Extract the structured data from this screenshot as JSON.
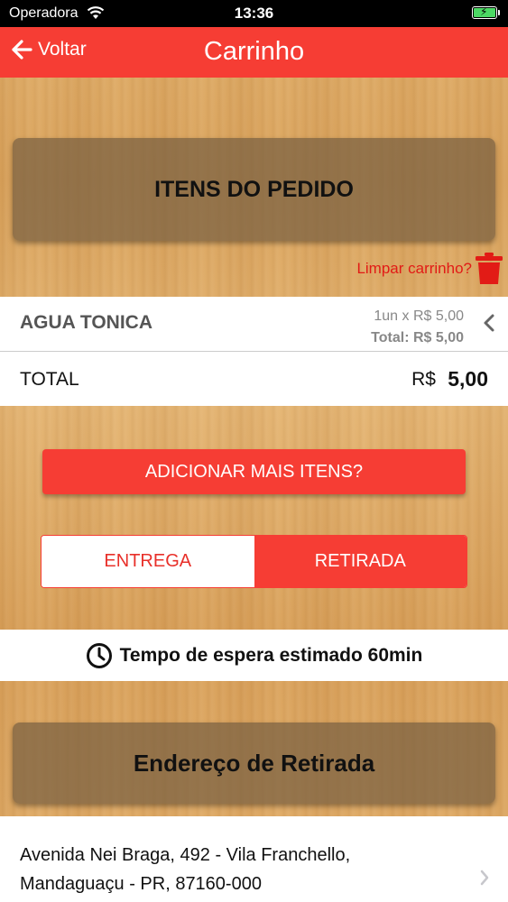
{
  "status_bar": {
    "carrier": "Operadora",
    "time": "13:36"
  },
  "nav": {
    "back_label": "Voltar",
    "title": "Carrinho"
  },
  "order_items_header": "ITENS DO PEDIDO",
  "clear_cart_label": "Limpar carrinho?",
  "cart_item": {
    "name": "AGUA TONICA",
    "quantity_price": "1un x R$ 5,00",
    "total": "Total: R$ 5,00"
  },
  "total": {
    "label": "TOTAL",
    "currency": "R$",
    "value": "5,00"
  },
  "add_more_label": "ADICIONAR MAIS ITENS?",
  "delivery_options": {
    "delivery": "ENTREGA",
    "pickup": "RETIRADA",
    "selected": "RETIRADA"
  },
  "wait_time_label": "Tempo de espera estimado 60min",
  "pickup_address_header": "Endereço de Retirada",
  "address": {
    "line1": "Avenida Nei Braga, 492 - Vila Franchello,",
    "line2": "Mandaguaçu - PR, 87160-000"
  },
  "colors": {
    "accent": "#f63d34",
    "clear_cart": "#e21b16",
    "battery": "#4cd964"
  },
  "icons": [
    "wifi-icon",
    "battery-icon",
    "back-arrow-icon",
    "trash-icon",
    "chevron-left-icon",
    "clock-icon",
    "chevron-right-icon"
  ]
}
